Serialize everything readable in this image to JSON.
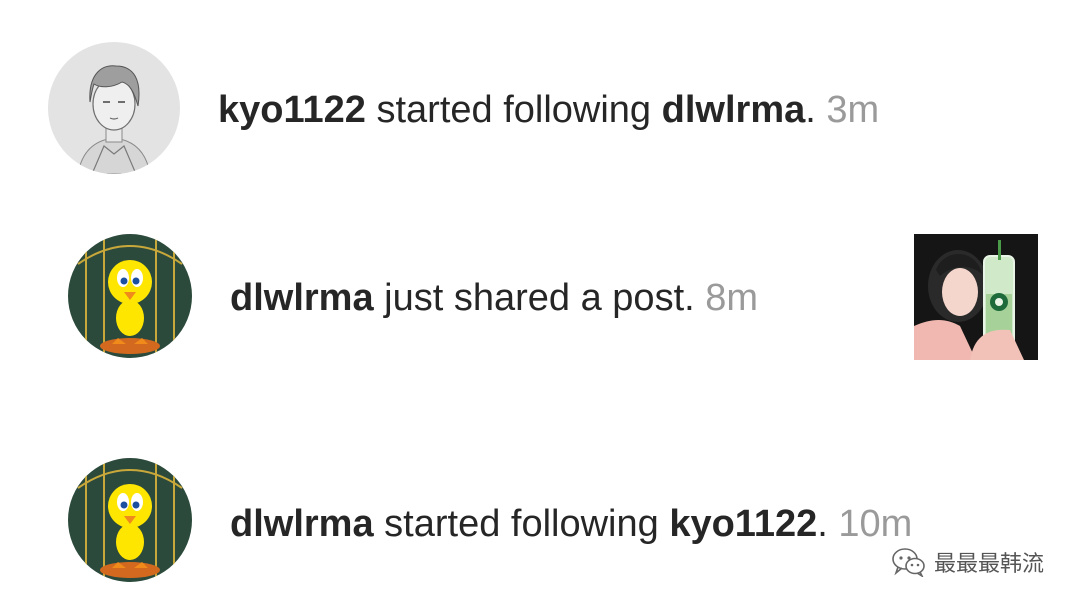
{
  "notifications": [
    {
      "avatar": "sketch-portrait-avatar",
      "actor": "kyo1122",
      "action": " started following ",
      "target": "dlwlrma",
      "punct": ".",
      "time": "3m"
    },
    {
      "avatar": "yellow-bird-avatar",
      "actor": "dlwlrma",
      "action": " just shared a post.",
      "time": "8m",
      "thumbnail": "post-photo-thumbnail"
    },
    {
      "avatar": "yellow-bird-avatar",
      "actor": "dlwlrma",
      "action": " started following ",
      "target": "kyo1122",
      "punct": ".",
      "time": "10m"
    }
  ],
  "watermark": {
    "icon": "wechat-icon",
    "text": "最最最韩流"
  },
  "colors": {
    "text": "#262626",
    "time": "#9a9a9a",
    "background": "#ffffff"
  }
}
